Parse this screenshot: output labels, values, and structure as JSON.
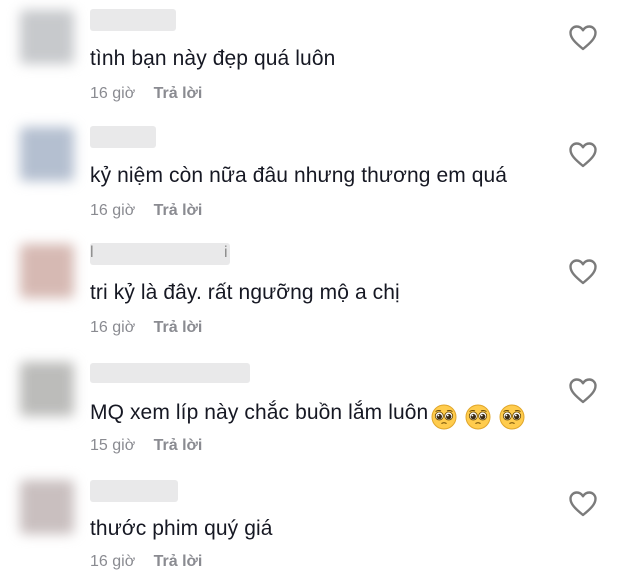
{
  "comments": [
    {
      "text": "tình bạn này đẹp quá luôn",
      "time": "16 giờ",
      "reply": "Trả lời",
      "name_initial": "",
      "name_tail": "",
      "avatar_color": "#c7c9cc",
      "name_width_pct": 55
    },
    {
      "text": "kỷ niệm còn nữa đâu nhưng thương em quá",
      "time": "16 giờ",
      "reply": "Trả lời",
      "name_initial": "",
      "name_tail": "",
      "avatar_color": "#b4bfd0",
      "name_width_pct": 30
    },
    {
      "text": "tri kỷ là đây. rất ngưỡng mộ a chị",
      "time": "16 giờ",
      "reply": "Trả lời",
      "name_initial": "l",
      "name_tail": "i",
      "avatar_color": "#d6b9b3",
      "name_width_pct": 100
    },
    {
      "text": "MQ xem líp này chắc buồn lắm luôn",
      "time": "15 giờ",
      "reply": "Trả lời",
      "name_initial": "",
      "name_tail": "",
      "avatar_color": "#bcbcba",
      "name_width_pct": 100,
      "emojis": [
        "pleading-face-emoji",
        "pleading-face-emoji",
        "pleading-face-emoji"
      ]
    },
    {
      "text": "thước phim quý giá",
      "time": "16 giờ",
      "reply": "Trả lời",
      "name_initial": "",
      "name_tail": "",
      "avatar_color": "#c9bfbf",
      "name_width_pct": 52
    }
  ],
  "icons": {
    "like": "heart-outline-icon"
  },
  "colors": {
    "text": "#161823",
    "meta": "#8a8b91",
    "heart": "#7b7b7b"
  }
}
